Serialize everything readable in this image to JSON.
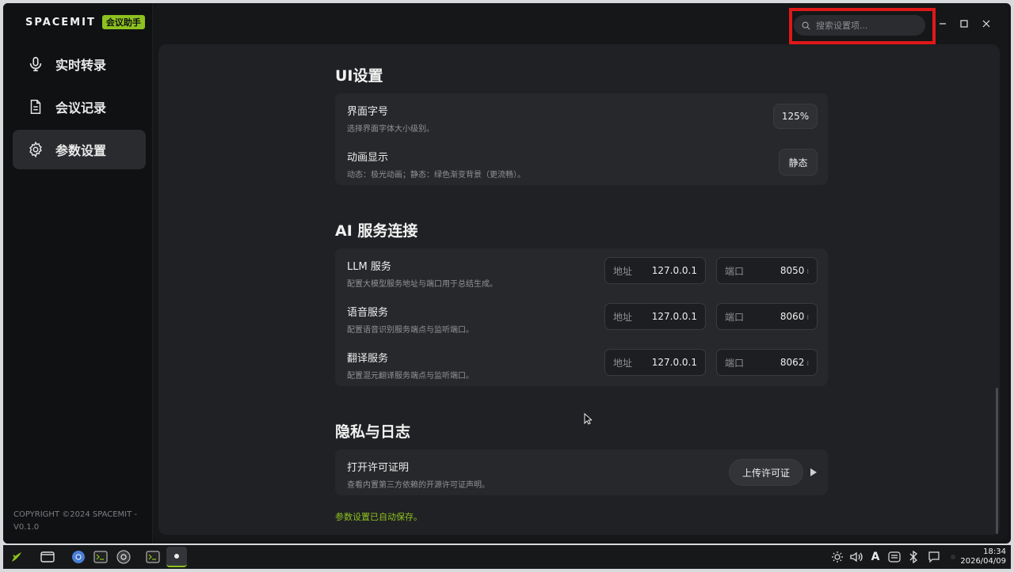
{
  "sidebar": {
    "brand_logo": "SPACEMIT",
    "brand_badge": "会议助手",
    "items": [
      {
        "label": "实时转录",
        "icon": "microphone-icon"
      },
      {
        "label": "会议记录",
        "icon": "document-icon"
      },
      {
        "label": "参数设置",
        "icon": "gear-icon"
      }
    ],
    "copyright": "COPYRIGHT ©2024 SPACEMIT - V0.1.0"
  },
  "header": {
    "search_placeholder": "搜索设置项..."
  },
  "sections": {
    "ui": {
      "title": "UI设置",
      "font_size": {
        "title": "界面字号",
        "desc": "选择界面字体大小级别。",
        "value": "125%"
      },
      "animation": {
        "title": "动画显示",
        "desc": "动态：极光动画；静态：绿色渐变背景（更流畅）。",
        "value": "静态"
      }
    },
    "ai": {
      "title": "AI 服务连接",
      "address_label": "地址",
      "port_label": "端口",
      "services": [
        {
          "title": "LLM 服务",
          "desc": "配置大模型服务地址与端口用于总结生成。",
          "address": "127.0.0.1",
          "port": "8050"
        },
        {
          "title": "语音服务",
          "desc": "配置语音识别服务端点与监听端口。",
          "address": "127.0.0.1",
          "port": "8060"
        },
        {
          "title": "翻译服务",
          "desc": "配置混元翻译服务端点与监听端口。",
          "address": "127.0.0.1",
          "port": "8062"
        }
      ]
    },
    "privacy": {
      "title": "隐私与日志",
      "license": {
        "title": "打开许可证明",
        "desc": "查看内置第三方依赖的开源许可证声明。",
        "button": "上传许可证"
      }
    }
  },
  "status": {
    "autosave": "参数设置已自动保存。"
  },
  "taskbar": {
    "time": "18:34",
    "date": "2026/04/09",
    "ime": "A"
  },
  "colors": {
    "accent": "#8dc21f",
    "highlight": "#e01818"
  }
}
